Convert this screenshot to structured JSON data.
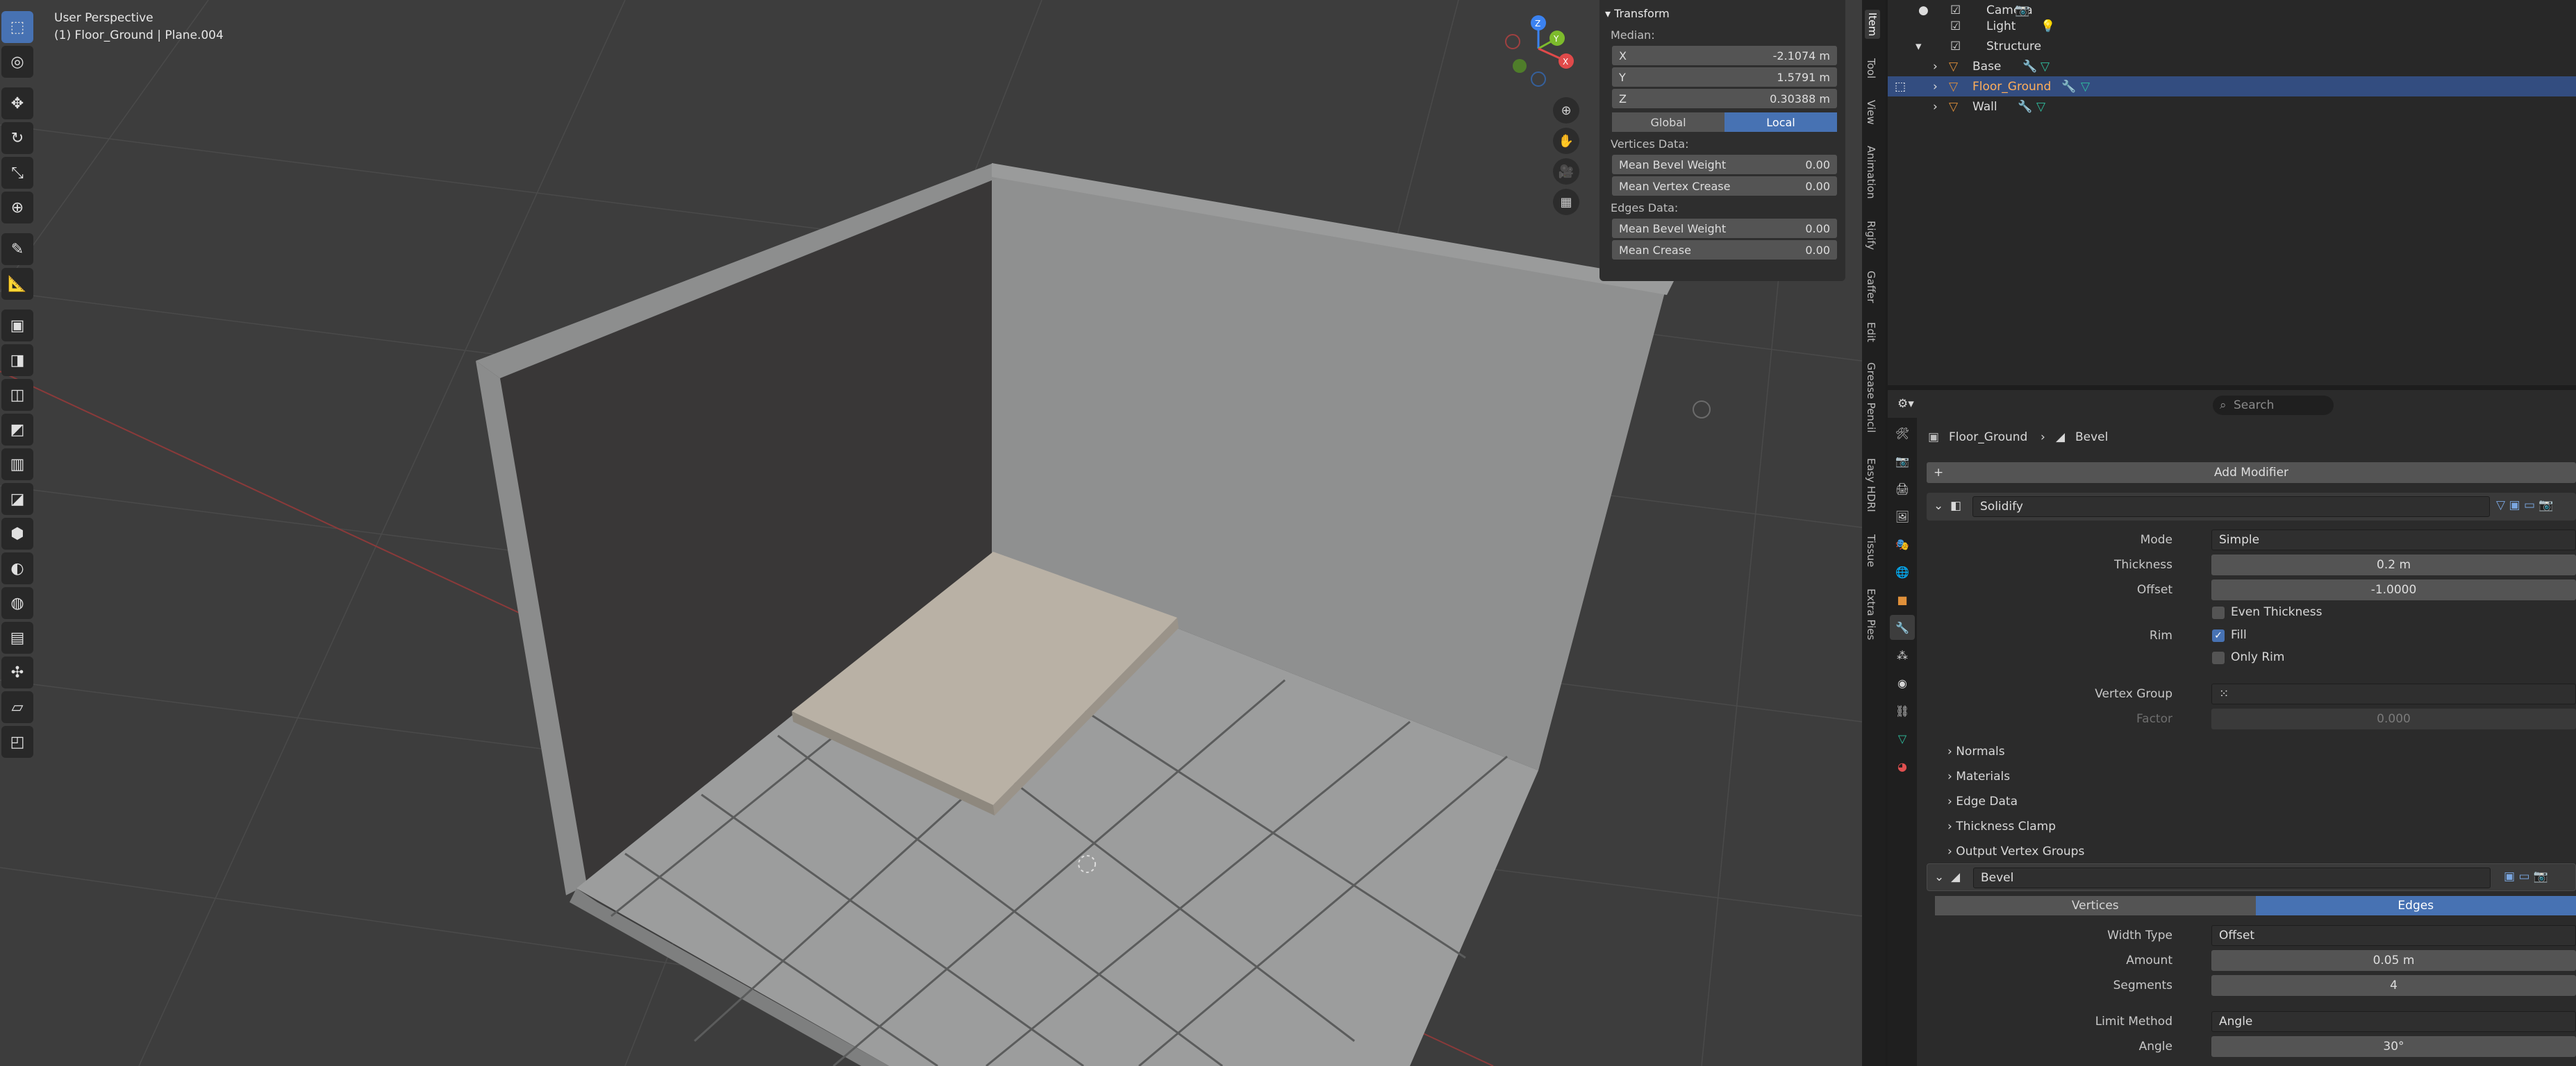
{
  "viewport": {
    "perspective": "User Perspective",
    "object_info": "(1) Floor_Ground | Plane.004",
    "tools": [
      "select-box-icon",
      "cursor-icon",
      "move-icon",
      "rotate-icon",
      "scale-icon",
      "transform-icon",
      "annotate-icon",
      "measure-icon",
      "add-cube-icon",
      "extrude-icon",
      "inset-icon",
      "bevel-icon",
      "loop-cut-icon",
      "knife-icon",
      "poly-build-icon",
      "spin-icon",
      "smooth-icon",
      "edge-slide-icon",
      "shrink-fatten-icon",
      "shear-icon",
      "rip-icon"
    ],
    "axes": {
      "x": "X",
      "y": "Y",
      "z": "Z"
    }
  },
  "npanel": {
    "title": "Transform",
    "median_label": "Median:",
    "x_label": "X",
    "x_value": "-2.1074 m",
    "y_label": "Y",
    "y_value": "1.5791 m",
    "z_label": "Z",
    "z_value": "0.30388 m",
    "global": "Global",
    "local": "Local",
    "vertices_label": "Vertices Data:",
    "v_bevel_label": "Mean Bevel Weight",
    "v_bevel_value": "0.00",
    "v_crease_label": "Mean Vertex Crease",
    "v_crease_value": "0.00",
    "edges_label": "Edges Data:",
    "e_bevel_label": "Mean Bevel Weight",
    "e_bevel_value": "0.00",
    "e_crease_label": "Mean Crease",
    "e_crease_value": "0.00",
    "tabs": [
      "Item",
      "Tool",
      "View",
      "Animation",
      "Rigify",
      "Gaffer",
      "Edit",
      "Grease Pencil",
      "Easy HDRI",
      "Tissue",
      "Extra Pies"
    ]
  },
  "outliner": {
    "rows": [
      {
        "label": "Camera"
      },
      {
        "label": "Light"
      },
      {
        "label": "Structure"
      },
      {
        "label": "Base"
      },
      {
        "label": "Floor_Ground"
      },
      {
        "label": "Wall"
      }
    ]
  },
  "properties": {
    "search_placeholder": "Search",
    "breadcrumb_object": "Floor_Ground",
    "breadcrumb_modifier": "Bevel",
    "add_modifier": "Add Modifier",
    "solidify": {
      "name": "Solidify",
      "mode_label": "Mode",
      "mode_value": "Simple",
      "thickness_label": "Thickness",
      "thickness_value": "0.2 m",
      "offset_label": "Offset",
      "offset_value": "-1.0000",
      "even_thickness": "Even Thickness",
      "rim_label": "Rim",
      "fill": "Fill",
      "only_rim": "Only Rim",
      "vertex_group_label": "Vertex Group",
      "factor_label": "Factor",
      "factor_value": "0.000",
      "sections": [
        "Normals",
        "Materials",
        "Edge Data",
        "Thickness Clamp",
        "Output Vertex Groups"
      ]
    },
    "bevel": {
      "name": "Bevel",
      "vertices": "Vertices",
      "edges": "Edges",
      "width_type_label": "Width Type",
      "width_type_value": "Offset",
      "amount_label": "Amount",
      "amount_value": "0.05 m",
      "segments_label": "Segments",
      "segments_value": "4",
      "limit_label": "Limit Method",
      "limit_value": "Angle",
      "angle_label": "Angle",
      "angle_value": "30°"
    }
  },
  "colors": {
    "accent": "#4772b3",
    "selected_row": "#334d80",
    "viewport_bg": "#3d3d3d"
  }
}
